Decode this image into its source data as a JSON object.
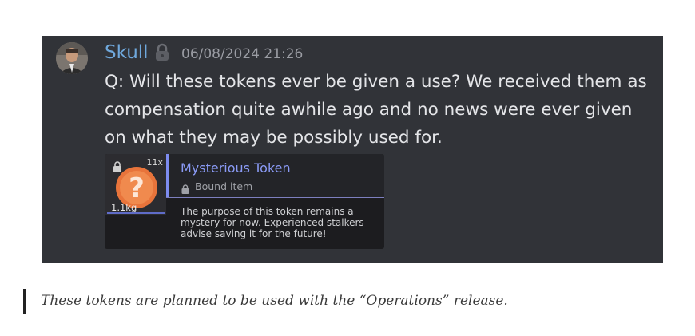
{
  "message": {
    "author": "Skull",
    "timestamp": "06/08/2024 21:26",
    "text": "Q: Will these tokens ever be given a use? We received them as compensation quite awhile ago and no news were ever given on what they may be possibly used for.",
    "badge_icon": "padlock-badge-icon",
    "colors": {
      "background": "#313338",
      "author": "#6fa8dc",
      "text": "#e4e5e8"
    }
  },
  "item_card": {
    "count": "11x",
    "weight": "1.1kg",
    "name": "Mysterious Token",
    "bound_label": "Bound item",
    "description": "The purpose of this token remains a mystery for now. Experienced stalkers advise saving it for the future!",
    "icon": "question-mark-token-icon",
    "colors": {
      "name": "#8a9af5",
      "accent": "#7d8cf0",
      "token": "#e8743b"
    }
  },
  "quote": {
    "text": "These tokens are planned to be used with the “Operations”  release."
  }
}
